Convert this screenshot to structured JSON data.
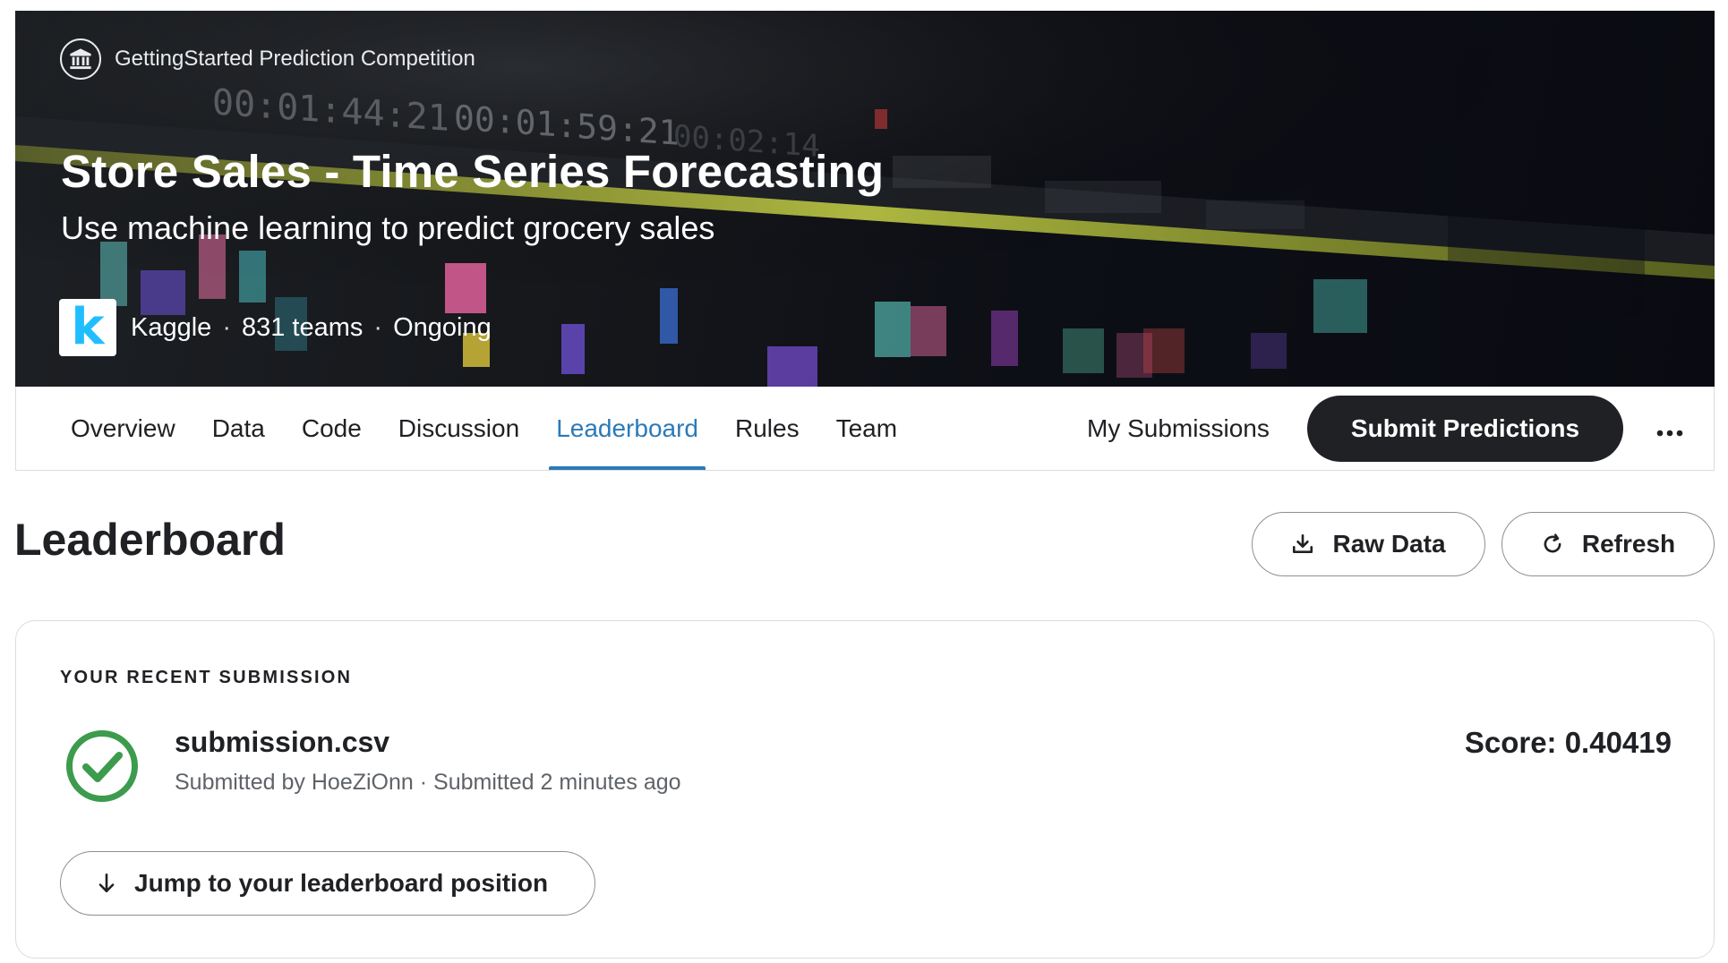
{
  "hero": {
    "badge_icon": "institution-icon",
    "competition_type": "GettingStarted Prediction Competition",
    "title": "Store Sales - Time Series Forecasting",
    "subtitle": "Use machine learning to predict grocery sales",
    "host_logo_letter": "k",
    "host": "Kaggle",
    "teams": "831 teams",
    "status": "Ongoing",
    "separator": "·"
  },
  "nav": {
    "tabs": [
      {
        "label": "Overview",
        "active": false
      },
      {
        "label": "Data",
        "active": false
      },
      {
        "label": "Code",
        "active": false
      },
      {
        "label": "Discussion",
        "active": false
      },
      {
        "label": "Leaderboard",
        "active": true
      },
      {
        "label": "Rules",
        "active": false
      },
      {
        "label": "Team",
        "active": false
      }
    ],
    "my_submissions": "My Submissions",
    "submit_label": "Submit Predictions",
    "more_icon": "more-horizontal-icon"
  },
  "leaderboard": {
    "title": "Leaderboard",
    "raw_data_label": "Raw Data",
    "refresh_label": "Refresh"
  },
  "recent_submission": {
    "eyebrow": "YOUR RECENT SUBMISSION",
    "status_icon": "check-circle-icon",
    "file_name": "submission.csv",
    "meta": "Submitted by HoeZiOnn · Submitted 2 minutes ago",
    "score": "Score: 0.40419",
    "jump_label": "Jump to your leaderboard position"
  },
  "colors": {
    "accent_blue": "#2b7ab8",
    "success_green": "#3d9b4e",
    "kaggle_blue": "#20beff",
    "primary_dark": "#202124"
  }
}
